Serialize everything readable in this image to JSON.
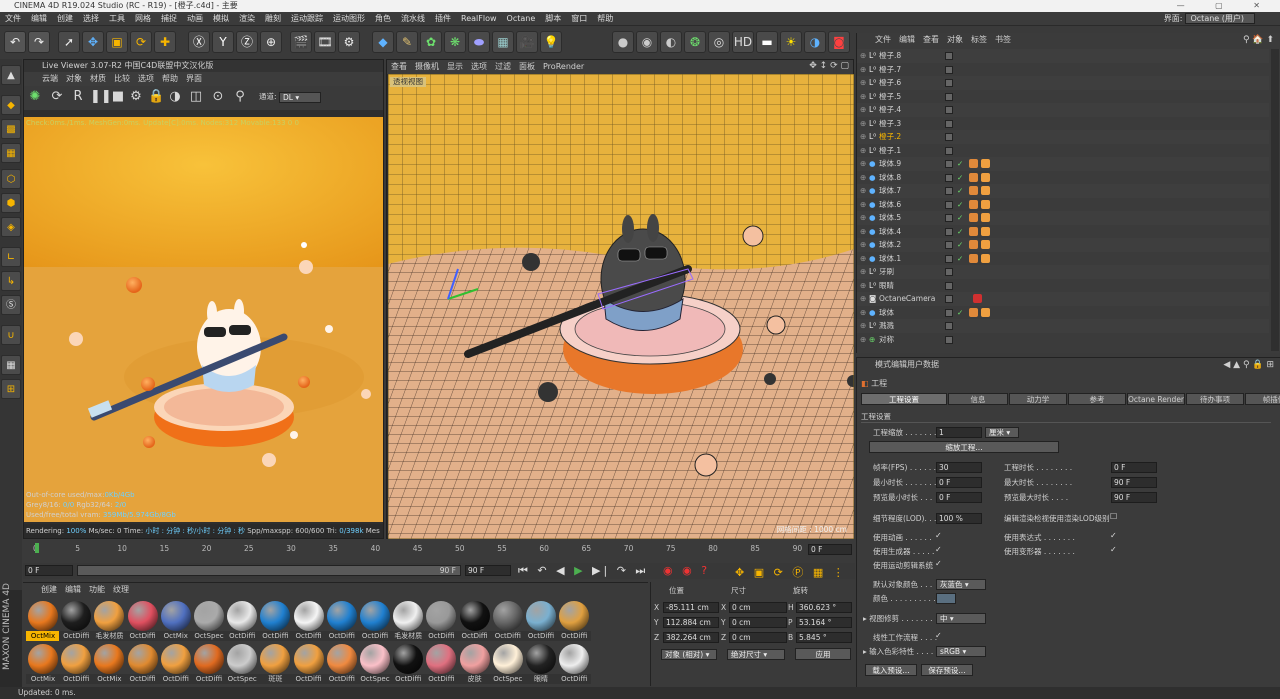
{
  "window_title": "CINEMA 4D R19.024 Studio (RC - R19) - [橙子.c4d] - 主要",
  "menubar": {
    "items": [
      "文件",
      "编辑",
      "创建",
      "选择",
      "工具",
      "网格",
      "捕捉",
      "动画",
      "模拟",
      "渲染",
      "雕刻",
      "运动跟踪",
      "运动图形",
      "角色",
      "流水线",
      "插件",
      "RealFlow",
      "Octane",
      "脚本",
      "窗口",
      "帮助"
    ],
    "interface_label": "界面:",
    "interface_value": "Octane (用户)"
  },
  "live_viewer": {
    "title": "Live Viewer 3.07-R2 中国C4D联盟中文汉化版",
    "menu": [
      "云端",
      "对象",
      "材质",
      "比较",
      "选项",
      "帮助",
      "界面"
    ],
    "channel_label": "通道:",
    "channel_value": "DL",
    "status_top": "Check:0ms./1ms. MeshGen:0ms. Update[C]:0ms. Nodes:312 Movable:133  0 0",
    "stats": [
      {
        "label": "Out-of-core used/max:",
        "value": "0Kb/4Gb"
      },
      {
        "label": "Grey8/16: ",
        "value": "0/0",
        "label2": "Rgb32/64: ",
        "value2": "2/0"
      },
      {
        "label": "Used/free/total vram: ",
        "value": "359Mb/5.974Gb/8Gb"
      }
    ],
    "render_line": {
      "rendering_label": "Rendering: ",
      "rendering_value": "100%",
      "mssec_label": "  Ms/sec: 0  Time: ",
      "time_value": "小时 : 分钟 : 秒/小时 : 分钟 : 秒",
      "spp_label": "  Spp/maxspp: 600/600",
      "tri_label": "  Tri: ",
      "tri_value": "0/398k",
      "mesh_label": "  Mes"
    }
  },
  "viewport": {
    "menu": [
      "查看",
      "摄像机",
      "显示",
      "选项",
      "过滤",
      "面板",
      "ProRender"
    ],
    "view_name": "透视视图",
    "grid_label": "网格间距 : 1000 cm"
  },
  "object_manager": {
    "menu": [
      "文件",
      "编辑",
      "查看",
      "对象",
      "标签",
      "书签"
    ],
    "rows": [
      {
        "name": "橙子.8",
        "type": "null",
        "highlight": false
      },
      {
        "name": "橙子.7",
        "type": "null",
        "highlight": false
      },
      {
        "name": "橙子.6",
        "type": "null",
        "highlight": false
      },
      {
        "name": "橙子.5",
        "type": "null",
        "highlight": false
      },
      {
        "name": "橙子.4",
        "type": "null",
        "highlight": false
      },
      {
        "name": "橙子.3",
        "type": "null",
        "highlight": false
      },
      {
        "name": "橙子.2",
        "type": "null",
        "highlight": true
      },
      {
        "name": "橙子.1",
        "type": "null",
        "highlight": false
      },
      {
        "name": "球体.9",
        "type": "sphere",
        "highlight": false
      },
      {
        "name": "球体.8",
        "type": "sphere",
        "highlight": false
      },
      {
        "name": "球体.7",
        "type": "sphere",
        "highlight": false
      },
      {
        "name": "球体.6",
        "type": "sphere",
        "highlight": false
      },
      {
        "name": "球体.5",
        "type": "sphere",
        "highlight": false
      },
      {
        "name": "球体.4",
        "type": "sphere",
        "highlight": false
      },
      {
        "name": "球体.2",
        "type": "sphere",
        "highlight": false
      },
      {
        "name": "球体.1",
        "type": "sphere",
        "highlight": false
      },
      {
        "name": "牙刷",
        "type": "null",
        "highlight": false
      },
      {
        "name": "眼睛",
        "type": "null",
        "highlight": false
      },
      {
        "name": "OctaneCamera",
        "type": "camera",
        "highlight": false
      },
      {
        "name": "球体",
        "type": "sphere",
        "highlight": false
      },
      {
        "name": "溅溅",
        "type": "null",
        "highlight": false
      },
      {
        "name": "对称",
        "type": "sym",
        "highlight": false
      }
    ]
  },
  "attributes": {
    "menu": [
      "模式",
      "编辑",
      "用户数据"
    ],
    "object_title": "工程",
    "tabs": [
      "工程设置",
      "信息",
      "动力学",
      "参考",
      "Octane Render",
      "待办事项",
      "帧插值"
    ],
    "section": "工程设置",
    "scale_label": "工程缩放 . . . . . . . . .",
    "scale_value": "1",
    "scale_unit": "厘米",
    "scale_button": "缩放工程...",
    "fps_label": "帧率(FPS) . . . . . .",
    "fps_value": "30",
    "project_time_label": "工程时长 . . . . . . . .",
    "project_time_value": "0 F",
    "min_time_label": "最小时长 . . . . . . .",
    "min_time_value": "0 F",
    "max_time_label": "最大时长 . . . . . . . .",
    "max_time_value": "90 F",
    "preview_min_label": "预览最小时长 . . .",
    "preview_min_value": "0 F",
    "preview_max_label": "预览最大时长 . . . .",
    "preview_max_value": "90 F",
    "lod_label": "细节程度(LOD). . .",
    "lod_value": "100 %",
    "lod_editor_label": "编辑渲染检视使用渲染LOD级别",
    "use_anim": "使用动画 . . . . . .",
    "use_expr": "使用表达式 . . . . . . .",
    "use_gen": "使用生成器 . . . . .",
    "use_deform": "使用变形器 . . . . . . .",
    "use_motion": "使用运动剪辑系统",
    "default_color_label": "默认对象颜色 . . .",
    "default_color_value": "灰蓝色",
    "color_label": "颜色 . . . . . . . . . .",
    "view_clip_label": "视图修剪 . . . . . . .",
    "view_clip_value": "中",
    "linear_label": "线性工作流程 . . . .",
    "input_color_label": "输入色彩特性 . . . .",
    "input_color_value": "sRGB",
    "load_preset": "载入预设...",
    "save_preset": "保存预设..."
  },
  "timeline": {
    "ticks": [
      "0",
      "5",
      "10",
      "15",
      "20",
      "25",
      "30",
      "35",
      "40",
      "45",
      "50",
      "55",
      "60",
      "65",
      "70",
      "75",
      "80",
      "85",
      "90"
    ],
    "current_frame": "0 F",
    "start": "0 F",
    "range_end": "90 F",
    "end": "90 F",
    "end_field": "0 F"
  },
  "material_manager": {
    "menu": [
      "创建",
      "编辑",
      "功能",
      "纹理"
    ],
    "row1": [
      "OctMix",
      "OctDiffi",
      "毛发材质",
      "OctDiffi",
      "OctMix",
      "OctSpec",
      "OctDiffi",
      "OctDiffi",
      "OctDiffi",
      "OctDiffi",
      "OctDiffi",
      "毛发材质",
      "OctDiffi",
      "OctDiffi",
      "OctDiffi",
      "OctDiffi",
      "OctDiffi"
    ],
    "row2": [
      "OctMix",
      "OctDiffi",
      "OctMix",
      "OctDiffi",
      "OctDiffi",
      "OctDiffi",
      "OctSpec",
      "斑斑",
      "OctDiffi",
      "OctDiffi",
      "OctSpec",
      "OctDiffi",
      "OctDiffi",
      "皮肤",
      "OctSpec",
      "眼睛",
      "OctDiffi"
    ]
  },
  "coordinates": {
    "headers": [
      "位置",
      "尺寸",
      "旋转"
    ],
    "x_pos": "-85.111 cm",
    "y_pos": "112.884 cm",
    "z_pos": "382.264 cm",
    "x_size": "0 cm",
    "y_size": "0 cm",
    "z_size": "0 cm",
    "h_rot": "360.623 °",
    "p_rot": "53.164 °",
    "b_rot": "5.845 °",
    "mode": "对象 (相对)",
    "size_mode": "绝对尺寸",
    "apply": "应用"
  },
  "statusbar": "Updated: 0 ms."
}
